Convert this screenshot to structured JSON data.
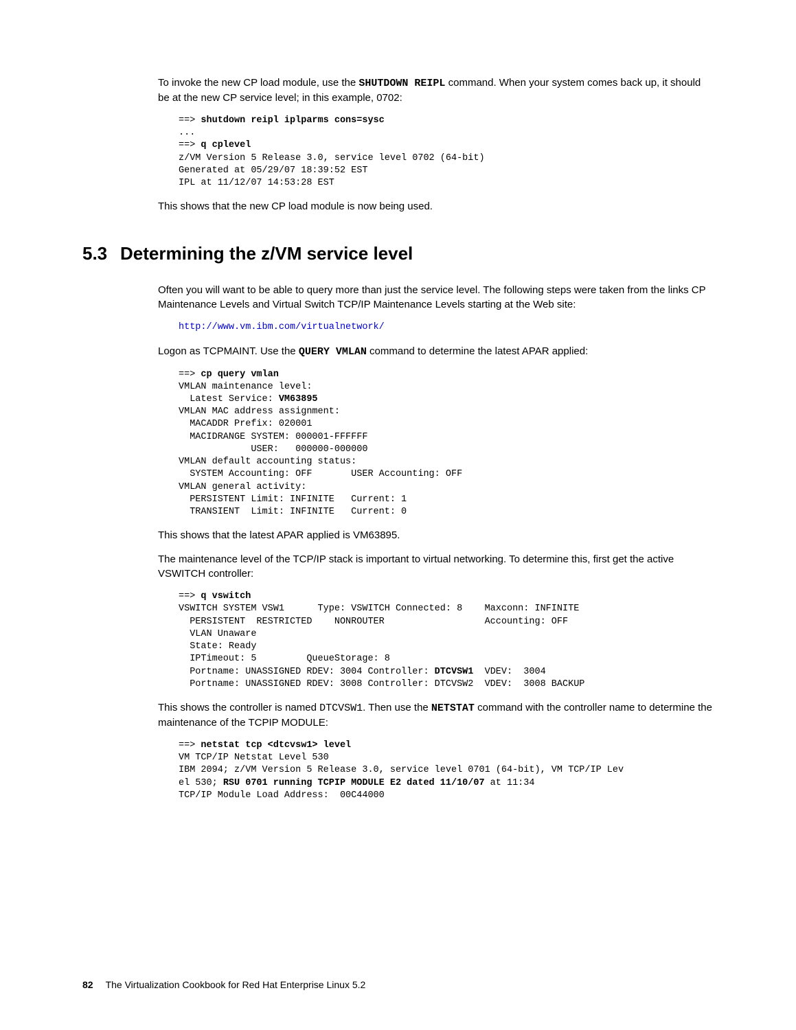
{
  "intro_para1_a": "To invoke the new CP load module, use the ",
  "intro_para1_cmd": "SHUTDOWN REIPL",
  "intro_para1_b": " command. When your system comes back up, it should be at the new CP service level; in this example, 0702:",
  "code1_l1a": "==> ",
  "code1_l1b": "shutdown reipl iplparms cons=sysc",
  "code1_l2": "...",
  "code1_l3a": "==> ",
  "code1_l3b": "q cplevel",
  "code1_l4": "z/VM Version 5 Release 3.0, service level 0702 (64-bit)",
  "code1_l5": "Generated at 05/29/07 18:39:52 EST",
  "code1_l6": "IPL at 11/12/07 14:53:28 EST",
  "intro_para2": "This shows that the new CP load module is now being used.",
  "section_num": "5.3",
  "section_title": "Determining the z/VM service level",
  "para3": "Often you will want to be able to query more than just the service level. The following steps were taken from the links CP Maintenance Levels and Virtual Switch TCP/IP Maintenance Levels starting at the Web site:",
  "url": "http://www.vm.ibm.com/virtualnetwork/",
  "para4_a": "Logon as TCPMAINT. Use the ",
  "para4_cmd": "QUERY VMLAN",
  "para4_b": " command to determine the latest APAR applied:",
  "code2_l1a": "==> ",
  "code2_l1b": "cp query vmlan",
  "code2_l2": "VMLAN maintenance level:",
  "code2_l3a": "  Latest Service: ",
  "code2_l3b": "VM63895",
  "code2_l4": "VMLAN MAC address assignment:",
  "code2_l5": "  MACADDR Prefix: 020001",
  "code2_l6": "  MACIDRANGE SYSTEM: 000001-FFFFFF",
  "code2_l7": "             USER:   000000-000000",
  "code2_l8": "VMLAN default accounting status:",
  "code2_l9": "  SYSTEM Accounting: OFF       USER Accounting: OFF",
  "code2_l10": "VMLAN general activity:",
  "code2_l11": "  PERSISTENT Limit: INFINITE   Current: 1",
  "code2_l12": "  TRANSIENT  Limit: INFINITE   Current: 0",
  "para5": "This shows that the latest APAR applied is VM63895.",
  "para6": "The maintenance level of the TCP/IP stack is important to virtual networking. To determine this, first get the active VSWITCH controller:",
  "code3_l1a": "==> ",
  "code3_l1b": "q vswitch",
  "code3_l2": "VSWITCH SYSTEM VSW1      Type: VSWITCH Connected: 8    Maxconn: INFINITE",
  "code3_l3": "  PERSISTENT  RESTRICTED    NONROUTER                  Accounting: OFF",
  "code3_l4": "  VLAN Unaware",
  "code3_l5": "  State: Ready",
  "code3_l6": "  IPTimeout: 5         QueueStorage: 8",
  "code3_l7a": "  Portname: UNASSIGNED RDEV: 3004 Controller: ",
  "code3_l7b": "DTCVSW1",
  "code3_l7c": "  VDEV:  3004",
  "code3_l8": "  Portname: UNASSIGNED RDEV: 3008 Controller: DTCVSW2  VDEV:  3008 BACKUP",
  "para7_a": "This shows the controller is named ",
  "para7_dtc": "DTCVSW1",
  "para7_b": ". Then use the ",
  "para7_cmd": "NETSTAT",
  "para7_c": " command with the controller name to determine the maintenance of the TCPIP MODULE:",
  "code4_l1a": "==> ",
  "code4_l1b": "netstat tcp <dtcvsw1> level",
  "code4_l2": "VM TCP/IP Netstat Level 530",
  "code4_l3a": "IBM 2094; z/VM Version 5 Release 3.0, service level 0701 (64-bit), VM TCP/IP Lev",
  "code4_l4a": "el 530; ",
  "code4_l4b": "RSU 0701 running TCPIP MODULE E2 dated 11/10/07",
  "code4_l4c": " at 11:34",
  "code4_l5": "TCP/IP Module Load Address:  00C44000",
  "footer_page": "82",
  "footer_title": "The Virtualization Cookbook for Red Hat Enterprise Linux 5.2"
}
